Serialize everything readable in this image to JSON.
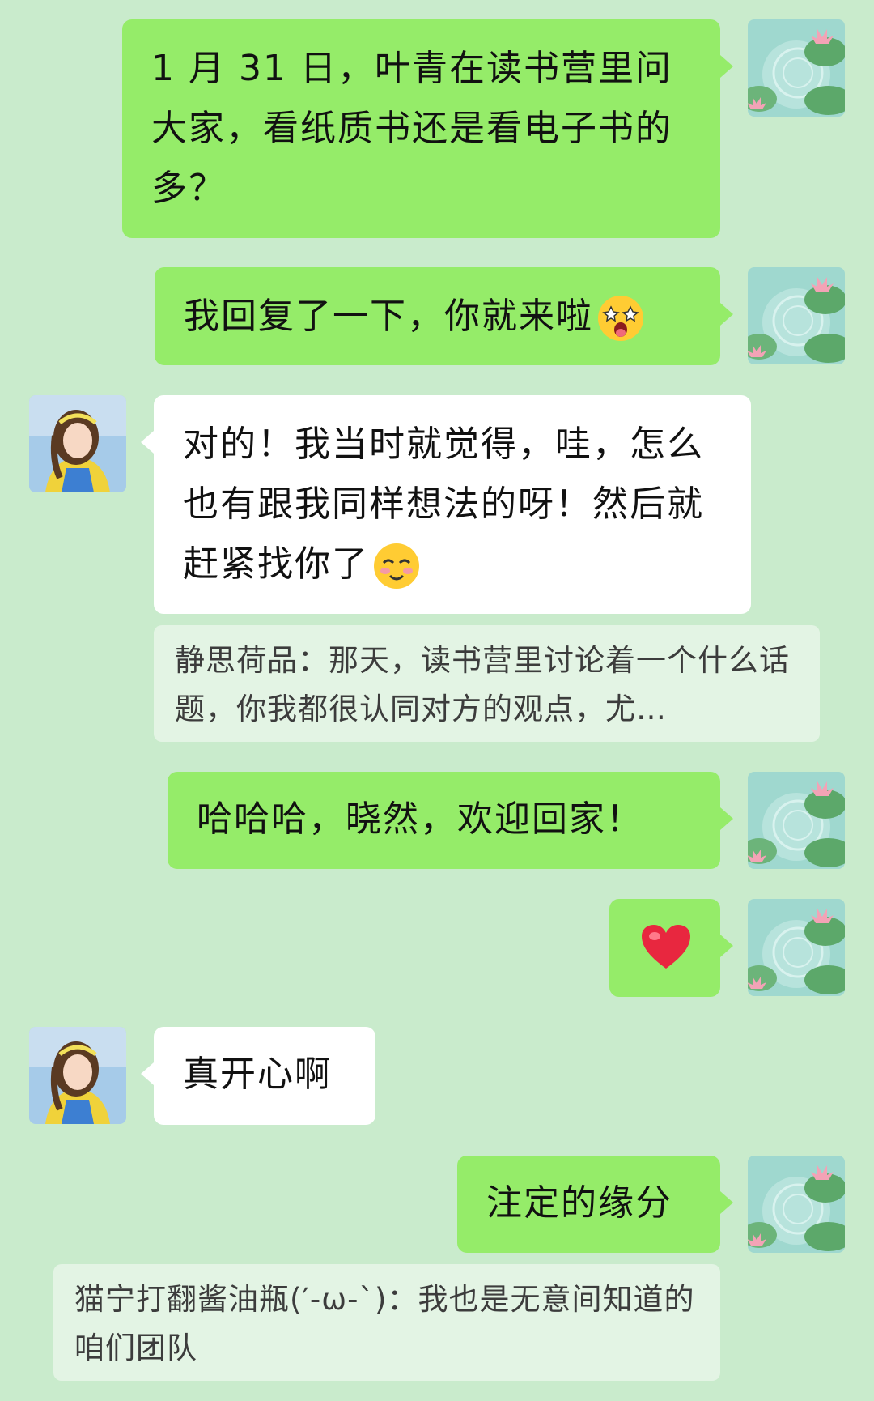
{
  "messages": [
    {
      "side": "out",
      "text": "1 月 31 日，叶青在读书营里问大家，看纸质书还是看电子书的多？"
    },
    {
      "side": "out",
      "text": "我回复了一下，你就来啦",
      "emoji": "star-struck-face-emoji"
    },
    {
      "side": "in",
      "text": "对的！我当时就觉得，哇，怎么也有跟我同样想法的呀！然后就赶紧找你了",
      "emoji": "blushing-smile-emoji"
    },
    {
      "side": "out",
      "text": "哈哈哈，晓然，欢迎回家！"
    },
    {
      "side": "out",
      "emoji": "red-heart-emoji"
    },
    {
      "side": "in",
      "text": "真开心啊"
    },
    {
      "side": "out",
      "text": "注定的缘分"
    }
  ],
  "quotes": [
    {
      "text": "静思荷品：那天，读书营里讨论着一个什么话题，你我都很认同对方的观点，尤…"
    },
    {
      "text": "猫宁打翻酱油瓶(′-ω-`)：我也是无意间知道的咱们团队"
    }
  ],
  "colors": {
    "background": "#c9ebcc",
    "outgoing_bubble": "#95ec69",
    "incoming_bubble": "#ffffff",
    "quote_bubble": "#e3f4e4"
  },
  "avatars": {
    "self": "lotus-pond-avatar",
    "other": "girl-portrait-avatar"
  }
}
